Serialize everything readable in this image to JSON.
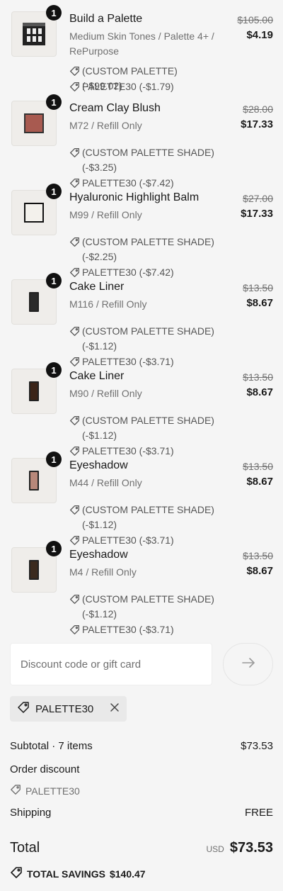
{
  "line_items": [
    {
      "quantity": "1",
      "name": "Build a Palette",
      "variant": "Medium Skin Tones / Palette 4+ / RePurpose",
      "discounts": [
        "(CUSTOM PALETTE) (-$99.02)",
        "PALETTE30 (-$1.79)"
      ],
      "original_price": "$105.00",
      "price": "$4.19",
      "thumbnail": "palette-icon",
      "swatch_color": "#222222"
    },
    {
      "quantity": "1",
      "name": "Cream Clay Blush",
      "variant": "M72 / Refill Only",
      "discounts": [
        "(CUSTOM PALETTE SHADE) (-$3.25)",
        "PALETTE30 (-$7.42)"
      ],
      "original_price": "$28.00",
      "price": "$17.33",
      "thumbnail": "square-swatch",
      "swatch_color": "#a85a50"
    },
    {
      "quantity": "1",
      "name": "Hyaluronic Highlight Balm",
      "variant": "M99 / Refill Only",
      "discounts": [
        "(CUSTOM PALETTE SHADE) (-$2.25)",
        "PALETTE30 (-$7.42)"
      ],
      "original_price": "$27.00",
      "price": "$17.33",
      "thumbnail": "square-swatch-outline",
      "swatch_color": "#f3f1ec"
    },
    {
      "quantity": "1",
      "name": "Cake Liner",
      "variant": "M116 / Refill Only",
      "discounts": [
        "(CUSTOM PALETTE SHADE) (-$1.12)",
        "PALETTE30 (-$3.71)"
      ],
      "original_price": "$13.50",
      "price": "$8.67",
      "thumbnail": "tall-swatch",
      "swatch_color": "#2a2a2a"
    },
    {
      "quantity": "1",
      "name": "Cake Liner",
      "variant": "M90 / Refill Only",
      "discounts": [
        "(CUSTOM PALETTE SHADE) (-$1.12)",
        "PALETTE30 (-$3.71)"
      ],
      "original_price": "$13.50",
      "price": "$8.67",
      "thumbnail": "tall-swatch",
      "swatch_color": "#3b2418"
    },
    {
      "quantity": "1",
      "name": "Eyeshadow",
      "variant": "M44 / Refill Only",
      "discounts": [
        "(CUSTOM PALETTE SHADE) (-$1.12)",
        "PALETTE30 (-$3.71)"
      ],
      "original_price": "$13.50",
      "price": "$8.67",
      "thumbnail": "tall-swatch",
      "swatch_color": "#b8887a"
    },
    {
      "quantity": "1",
      "name": "Eyeshadow",
      "variant": "M4 / Refill Only",
      "discounts": [
        "(CUSTOM PALETTE SHADE) (-$1.12)",
        "PALETTE30 (-$3.71)"
      ],
      "original_price": "$13.50",
      "price": "$8.67",
      "thumbnail": "tall-swatch",
      "swatch_color": "#3b2a1e"
    }
  ],
  "discount_form": {
    "placeholder": "Discount code or gift card",
    "value": "",
    "apply_icon": "arrow-right-icon"
  },
  "applied_code": {
    "code": "PALETTE30",
    "tag_icon": "tag-icon",
    "remove_icon": "close-icon"
  },
  "summary": {
    "subtotal_label": "Subtotal · 7 items",
    "subtotal_value": "$73.53",
    "order_discount_label": "Order discount",
    "order_discount_code": "PALETTE30",
    "shipping_label": "Shipping",
    "shipping_value": "FREE",
    "total_label": "Total",
    "currency": "USD",
    "total_value": "$73.53",
    "savings_label": "TOTAL SAVINGS",
    "savings_value": "$140.47"
  }
}
